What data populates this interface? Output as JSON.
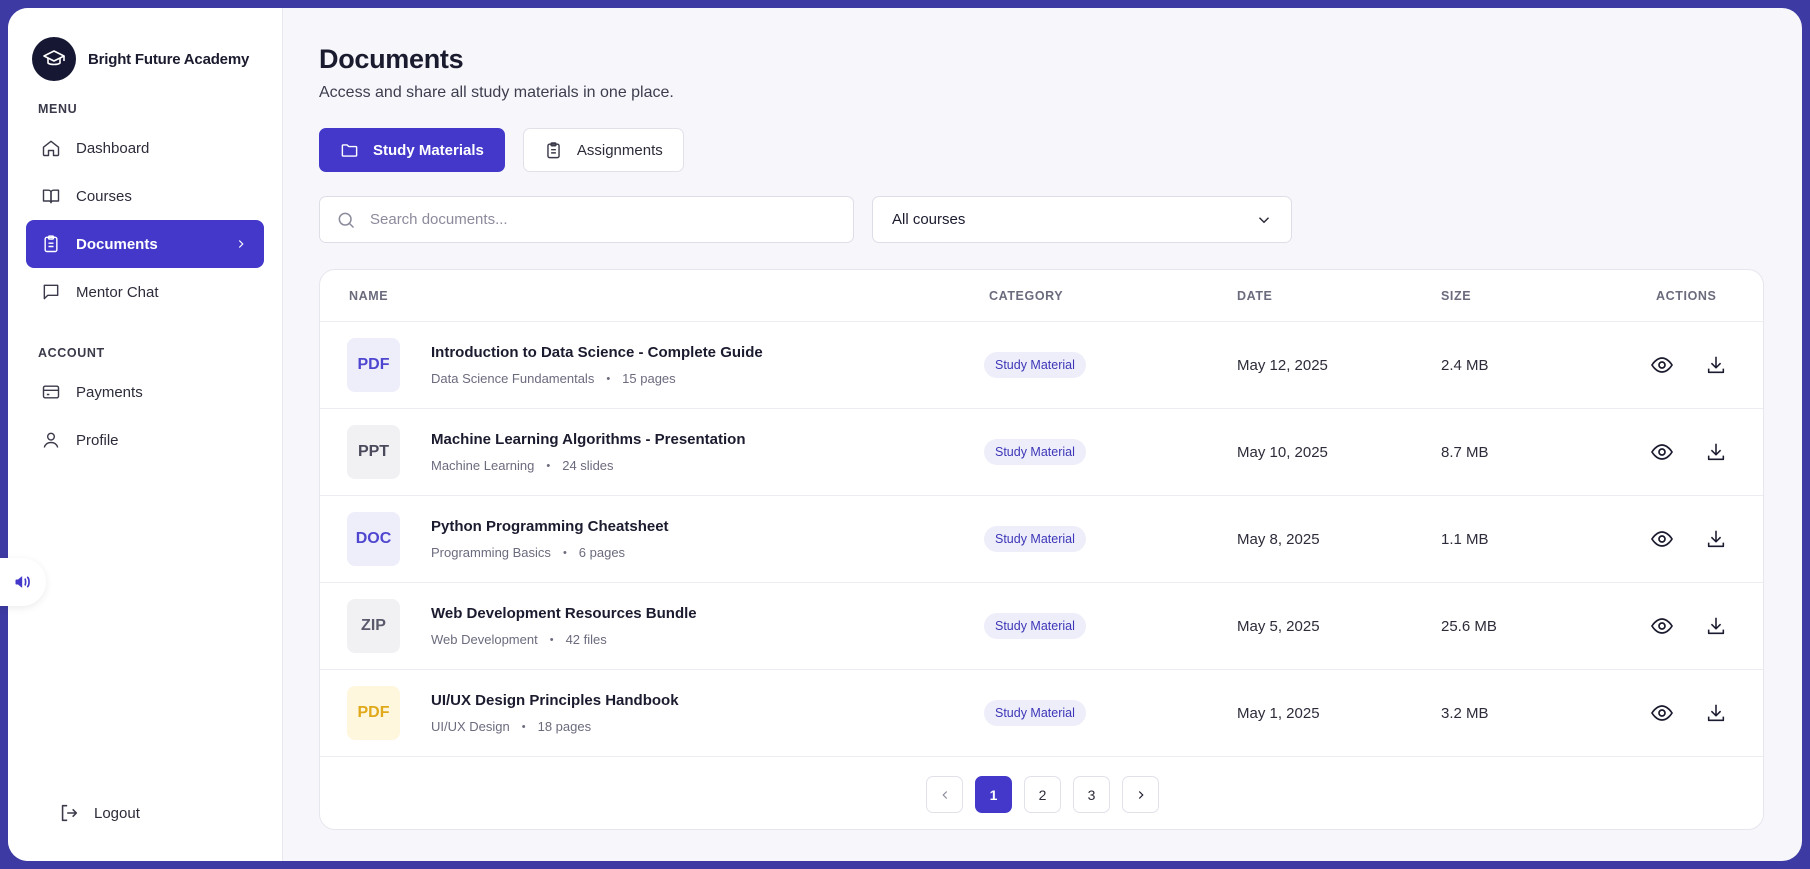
{
  "brand": {
    "name": "Bright Future Academy",
    "logo_icon": "graduation-cap-icon"
  },
  "sidebar": {
    "menu_label": "MENU",
    "menu_items": [
      {
        "label": "Dashboard",
        "icon": "home-icon"
      },
      {
        "label": "Courses",
        "icon": "book-open-icon"
      },
      {
        "label": "Documents",
        "icon": "clipboard-icon",
        "active": true
      },
      {
        "label": "Mentor Chat",
        "icon": "chat-icon"
      }
    ],
    "account_label": "ACCOUNT",
    "account_items": [
      {
        "label": "Payments",
        "icon": "credit-card-icon"
      },
      {
        "label": "Profile",
        "icon": "user-icon"
      }
    ],
    "logout_label": "Logout"
  },
  "page": {
    "title": "Documents",
    "subtitle": "Access and share all study materials in one place."
  },
  "tabs": [
    {
      "label": "Study Materials",
      "icon": "folder-icon",
      "active": true
    },
    {
      "label": "Assignments",
      "icon": "clipboard-icon",
      "active": false
    }
  ],
  "search": {
    "placeholder": "Search documents...",
    "value": ""
  },
  "course_filter": {
    "selected": "All courses"
  },
  "table": {
    "columns": {
      "name": "NAME",
      "category": "CATEGORY",
      "date": "DATE",
      "size": "SIZE",
      "actions": "ACTIONS"
    },
    "rows": [
      {
        "type": "PDF",
        "name": "Introduction to Data Science - Complete Guide",
        "course": "Data Science Fundamentals",
        "count": "15 pages",
        "category": "Study Material",
        "date": "May 12, 2025",
        "size": "2.4 MB"
      },
      {
        "type": "PPT",
        "name": "Machine Learning Algorithms - Presentation",
        "course": "Machine Learning",
        "count": "24 slides",
        "category": "Study Material",
        "date": "May 10, 2025",
        "size": "8.7 MB"
      },
      {
        "type": "DOC",
        "name": "Python Programming Cheatsheet",
        "course": "Programming Basics",
        "count": "6 pages",
        "category": "Study Material",
        "date": "May 8, 2025",
        "size": "1.1 MB"
      },
      {
        "type": "ZIP",
        "name": "Web Development Resources Bundle",
        "course": "Web Development",
        "count": "42 files",
        "category": "Study Material",
        "date": "May 5, 2025",
        "size": "25.6 MB"
      },
      {
        "type": "PDF",
        "name": "UI/UX Design Principles Handbook",
        "course": "UI/UX Design",
        "count": "18 pages",
        "category": "Study Material",
        "date": "May 1, 2025",
        "size": "3.2 MB"
      }
    ]
  },
  "pagination": {
    "pages": [
      "1",
      "2",
      "3"
    ],
    "current": "1"
  },
  "colors": {
    "accent": "#4338ca",
    "frame": "#3d3aa3",
    "pdf_alt": "#e0a91a"
  }
}
